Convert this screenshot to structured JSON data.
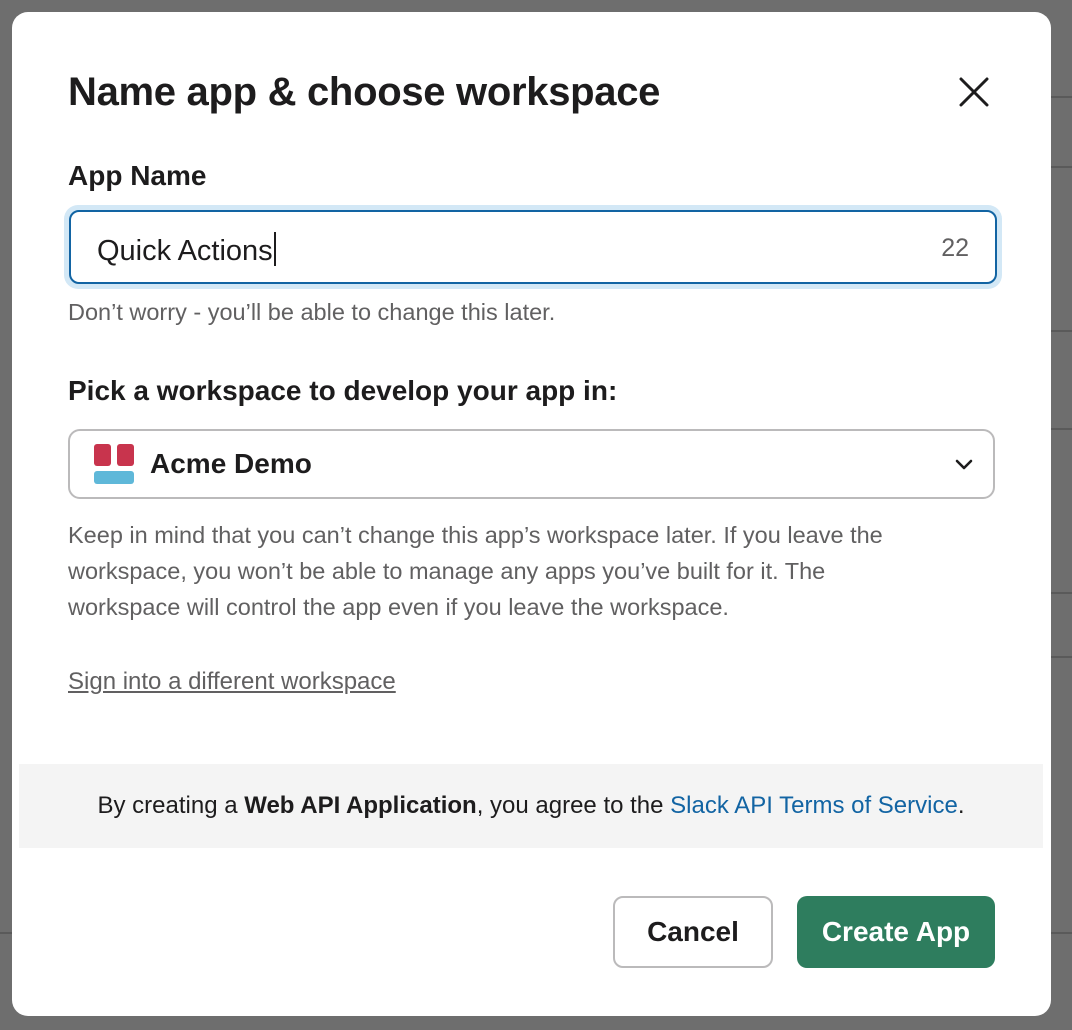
{
  "modal": {
    "title": "Name app & choose workspace",
    "close_icon": "close-icon"
  },
  "app_name": {
    "label": "App Name",
    "value": "Quick Actions",
    "char_counter": "22",
    "hint": "Don’t worry - you’ll be able to change this later."
  },
  "workspace": {
    "label": "Pick a workspace to develop your app in:",
    "selected": "Acme Demo",
    "logo_colors": [
      "#c8344d",
      "#5fb8d9"
    ],
    "dropdown_icon": "chevron-down-icon",
    "hint_lines": [
      "Keep in mind that you can’t change this app’s workspace later. If you leave the",
      "workspace, you won’t be able to manage any apps you’ve built for it. The",
      "workspace will control the app even if you leave the workspace."
    ],
    "switch_link": "Sign into a different workspace"
  },
  "terms": {
    "prefix": "By creating a ",
    "app_type": "Web API Application",
    "middle": ", you agree to the ",
    "link": "Slack API Terms of Service",
    "suffix": "."
  },
  "buttons": {
    "cancel": "Cancel",
    "create": "Create App"
  },
  "colors": {
    "primary_green": "#2e7d5e",
    "focus_blue": "#1264a3",
    "link_blue": "#1264a3"
  }
}
